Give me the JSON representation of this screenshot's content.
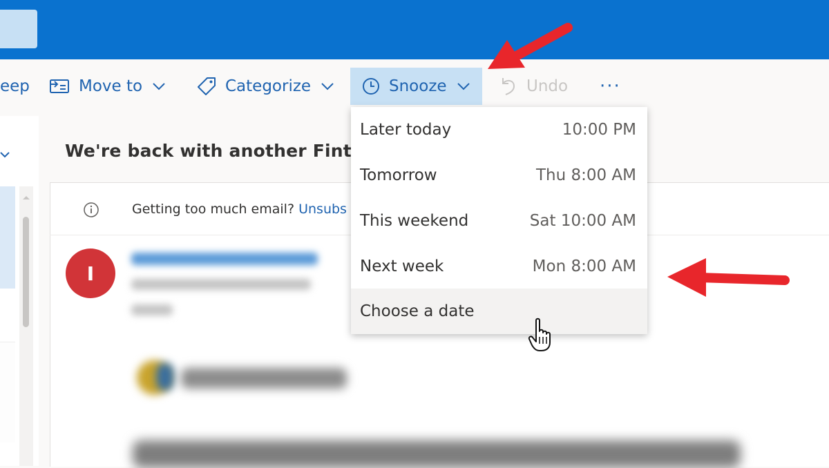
{
  "toolbar": {
    "sweep_label": "eep",
    "move_to_label": "Move to",
    "categorize_label": "Categorize",
    "snooze_label": "Snooze",
    "undo_label": "Undo",
    "more_label": "···"
  },
  "message": {
    "subject": "We're back with another Finte",
    "info_text": "Getting too much email?",
    "info_link": "Unsubs",
    "avatar_initial": "I"
  },
  "snooze_menu": {
    "items": [
      {
        "label": "Later today",
        "time": "10:00 PM"
      },
      {
        "label": "Tomorrow",
        "time": "Thu 8:00 AM"
      },
      {
        "label": "This weekend",
        "time": "Sat 10:00 AM"
      },
      {
        "label": "Next week",
        "time": "Mon 8:00 AM"
      },
      {
        "label": "Choose a date",
        "time": ""
      }
    ]
  },
  "colors": {
    "brand_blue": "#0a72cf",
    "link_blue": "#1f63b0",
    "snooze_highlight": "#c7e0f4",
    "avatar_red": "#d13438",
    "annotation_red": "#e8262b"
  },
  "icons": [
    "sweep-icon",
    "move-to-icon",
    "categorize-icon",
    "chevron-down-icon",
    "clock-icon",
    "undo-icon",
    "more-icon",
    "info-icon",
    "hand-cursor-icon",
    "annotation-arrow"
  ]
}
